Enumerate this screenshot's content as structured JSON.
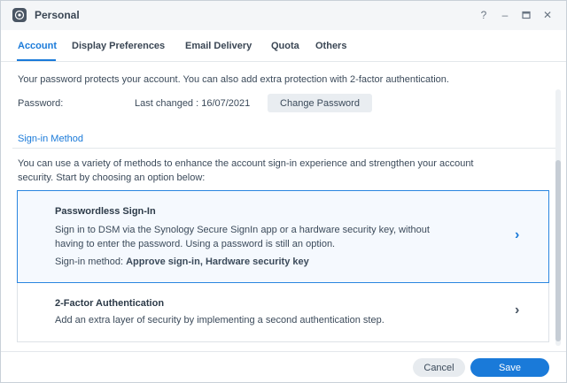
{
  "window": {
    "title": "Personal",
    "app_icon": "synology-dsm-icon",
    "controls": {
      "help": "?",
      "minimize": "–",
      "maximize": "▭",
      "close": "✕"
    }
  },
  "tabs": [
    {
      "label": "Account",
      "active": true
    },
    {
      "label": "Display Preferences",
      "active": false
    },
    {
      "label": "Email Delivery",
      "active": false
    },
    {
      "label": "Quota",
      "active": false
    },
    {
      "label": "Others",
      "active": false
    }
  ],
  "account": {
    "intro": "Your password protects your account. You can also add extra protection with 2-factor authentication.",
    "password_label": "Password:",
    "last_changed": "Last changed : 16/07/2021",
    "change_password_label": "Change Password"
  },
  "signin": {
    "section_title": "Sign-in Method",
    "description_line1": "You can use a variety of methods to enhance the account sign-in experience and strengthen your account",
    "description_line2": "security. Start by choosing an option below:",
    "cards": [
      {
        "title": "Passwordless Sign-In",
        "desc_line1": "Sign in to DSM via the Synology Secure SignIn app or a hardware security key, without",
        "desc_line2": "having to enter the password. Using a password is still an option.",
        "method_prefix": "Sign-in method: ",
        "method_value": "Approve sign-in, Hardware security key",
        "selected": true
      },
      {
        "title": "2-Factor Authentication",
        "desc_line1": "Add an extra layer of security by implementing a second authentication step.",
        "selected": false
      }
    ]
  },
  "footer": {
    "cancel_label": "Cancel",
    "save_label": "Save"
  },
  "colors": {
    "accent": "#1a7ad9",
    "titlebar_bg": "#f4f6f8",
    "text": "#3b4a5a"
  }
}
